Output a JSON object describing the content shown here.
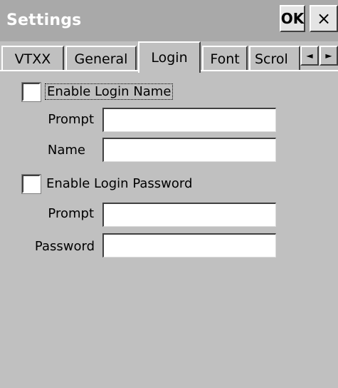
{
  "window": {
    "title": "Settings",
    "ok_label": "OK",
    "close_label": "×"
  },
  "tabs": [
    {
      "label": "VTXX",
      "active": false
    },
    {
      "label": "General",
      "active": false
    },
    {
      "label": "Login",
      "active": true
    },
    {
      "label": "Font",
      "active": false
    },
    {
      "label": "Scrol",
      "active": false
    }
  ],
  "tab_scroll": {
    "left_icon": "◄",
    "right_icon": "►"
  },
  "login_name": {
    "checkbox_label": "Enable Login Name",
    "checked": false,
    "prompt_label": "Prompt",
    "prompt_value": "",
    "name_label": "Name",
    "name_value": ""
  },
  "login_password": {
    "checkbox_label": "Enable Login Password",
    "checked": false,
    "prompt_label": "Prompt",
    "prompt_value": "",
    "password_label": "Password",
    "password_value": ""
  }
}
